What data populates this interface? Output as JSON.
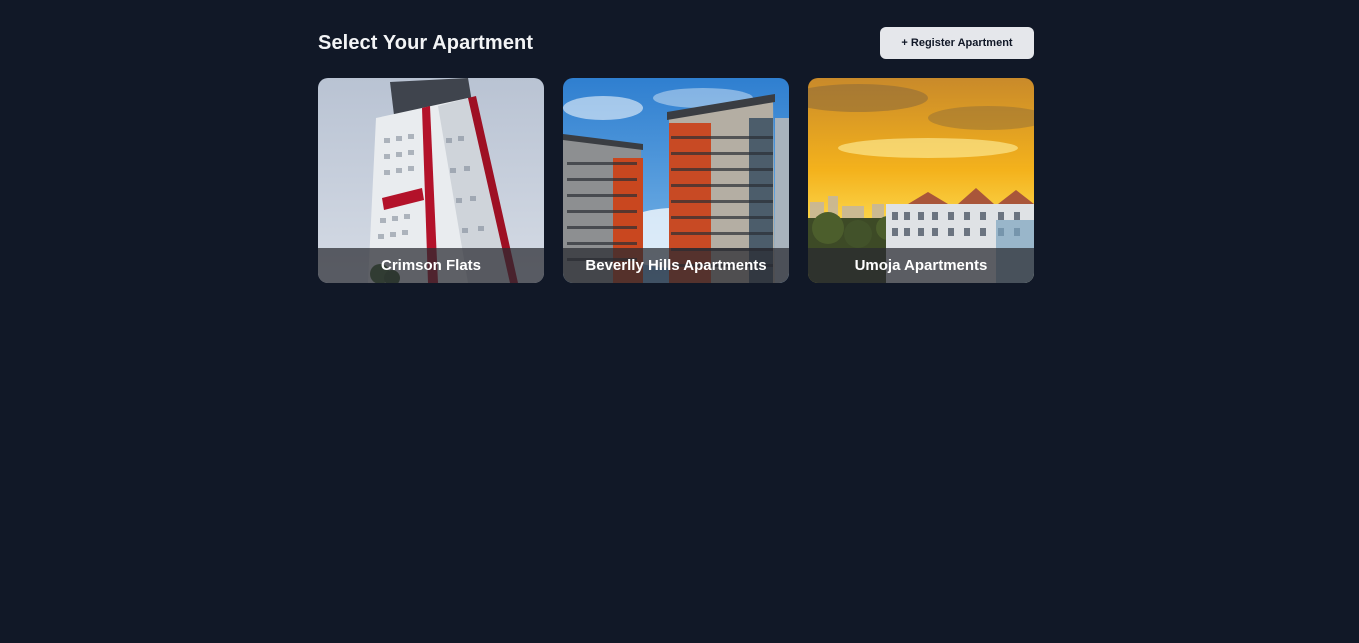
{
  "header": {
    "title": "Select Your Apartment",
    "register_label": "+ Register Apartment"
  },
  "apartments": [
    {
      "name": "Crimson Flats"
    },
    {
      "name": "Beverlly Hills Apartments"
    },
    {
      "name": "Umoja Apartments"
    }
  ],
  "colors": {
    "background": "#111827",
    "button_bg": "#e5e7eb",
    "title_text": "#f3f4f6"
  }
}
